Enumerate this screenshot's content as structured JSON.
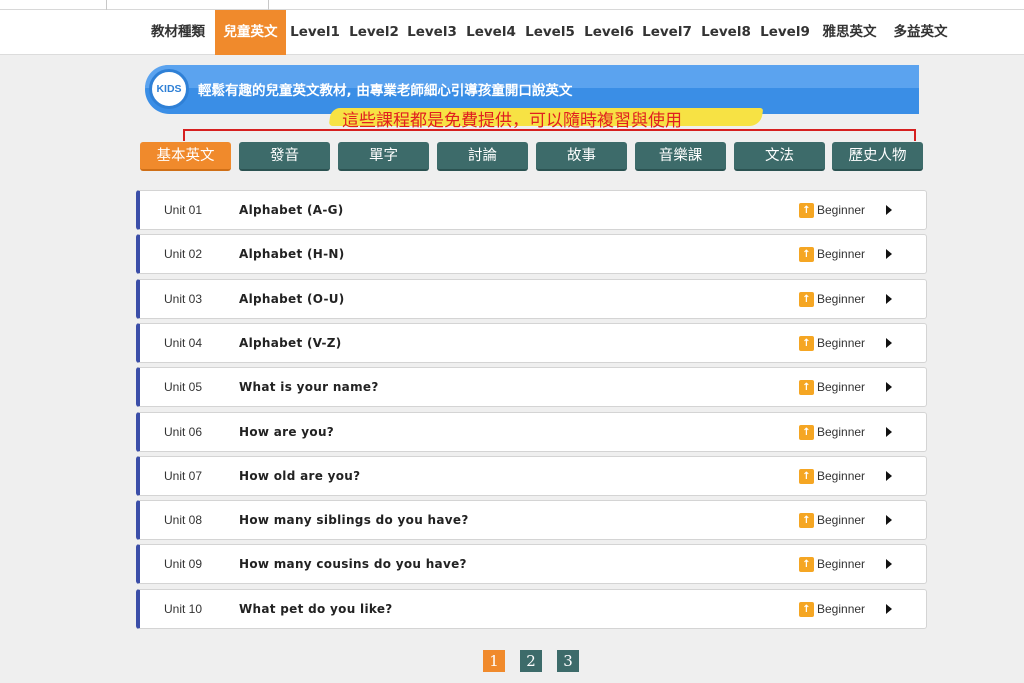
{
  "nav": {
    "items": [
      {
        "label": "教材種類",
        "active": false
      },
      {
        "label": "兒童英文",
        "active": true
      },
      {
        "label": "Level1",
        "active": false
      },
      {
        "label": "Level2",
        "active": false
      },
      {
        "label": "Level3",
        "active": false
      },
      {
        "label": "Level4",
        "active": false
      },
      {
        "label": "Level5",
        "active": false
      },
      {
        "label": "Level6",
        "active": false
      },
      {
        "label": "Level7",
        "active": false
      },
      {
        "label": "Level8",
        "active": false
      },
      {
        "label": "Level9",
        "active": false
      },
      {
        "label": "雅思英文",
        "active": false
      },
      {
        "label": "多益英文",
        "active": false
      }
    ]
  },
  "banner": {
    "badge": "KIDS",
    "text": "輕鬆有趣的兒童英文教材, 由專業老師細心引導孩童開口說英文"
  },
  "highlight": {
    "text": "這些課程都是免費提供，可以隨時複習與使用"
  },
  "tabs": [
    {
      "label": "基本英文",
      "active": true
    },
    {
      "label": "發音",
      "active": false
    },
    {
      "label": "單字",
      "active": false
    },
    {
      "label": "討論",
      "active": false
    },
    {
      "label": "故事",
      "active": false
    },
    {
      "label": "音樂課",
      "active": false
    },
    {
      "label": "文法",
      "active": false
    },
    {
      "label": "歷史人物",
      "active": false
    }
  ],
  "units": [
    {
      "unit": "Unit 01",
      "title": "Alphabet (A-G)",
      "level": "Beginner"
    },
    {
      "unit": "Unit 02",
      "title": "Alphabet (H-N)",
      "level": "Beginner"
    },
    {
      "unit": "Unit 03",
      "title": "Alphabet (O-U)",
      "level": "Beginner"
    },
    {
      "unit": "Unit 04",
      "title": "Alphabet (V-Z)",
      "level": "Beginner"
    },
    {
      "unit": "Unit 05",
      "title": "What is your name?",
      "level": "Beginner"
    },
    {
      "unit": "Unit 06",
      "title": "How are you?",
      "level": "Beginner"
    },
    {
      "unit": "Unit 07",
      "title": "How old are you?",
      "level": "Beginner"
    },
    {
      "unit": "Unit 08",
      "title": "How many siblings do you have?",
      "level": "Beginner"
    },
    {
      "unit": "Unit 09",
      "title": "How many cousins do you have?",
      "level": "Beginner"
    },
    {
      "unit": "Unit 10",
      "title": "What pet do you like?",
      "level": "Beginner"
    }
  ],
  "level_icon": "level-up-icon",
  "pagination": {
    "pages": [
      "1",
      "2",
      "3"
    ],
    "current": "1"
  },
  "colors": {
    "accent": "#f08a2c",
    "tab": "#3d6b6a",
    "banner": "#3a8ee6",
    "row_border": "#3b4ea8",
    "highlight": "#f7e244",
    "highlight_text": "#e02020"
  }
}
